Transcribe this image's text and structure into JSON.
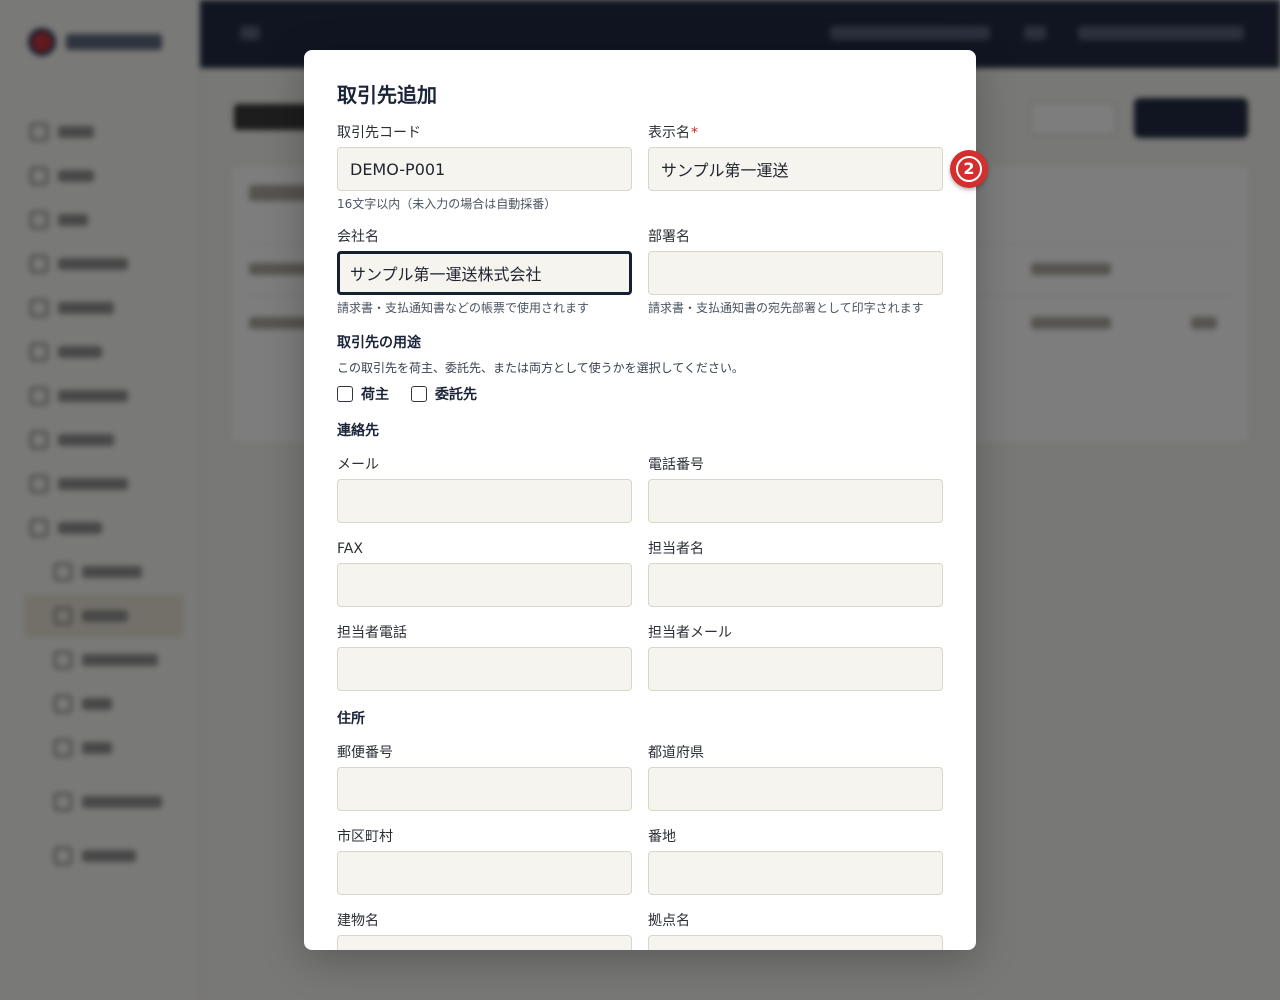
{
  "modal": {
    "title": "取引先追加",
    "fields": {
      "partner_code": {
        "label": "取引先コード",
        "value": "DEMO-P001",
        "hint": "16文字以内（未入力の場合は自動採番）"
      },
      "display_name": {
        "label": "表示名",
        "required_mark": "*",
        "value": "サンプル第一運送"
      },
      "company_name": {
        "label": "会社名",
        "value": "サンプル第一運送株式会社",
        "hint": "請求書・支払通知書などの帳票で使用されます"
      },
      "department": {
        "label": "部署名",
        "value": "",
        "hint": "請求書・支払通知書の宛先部署として印字されます"
      },
      "email": {
        "label": "メール",
        "value": ""
      },
      "phone": {
        "label": "電話番号",
        "value": ""
      },
      "fax": {
        "label": "FAX",
        "value": ""
      },
      "contact_name": {
        "label": "担当者名",
        "value": ""
      },
      "contact_phone": {
        "label": "担当者電話",
        "value": ""
      },
      "contact_email": {
        "label": "担当者メール",
        "value": ""
      },
      "postal_code": {
        "label": "郵便番号",
        "value": ""
      },
      "prefecture": {
        "label": "都道府県",
        "value": ""
      },
      "city": {
        "label": "市区町村",
        "value": ""
      },
      "street": {
        "label": "番地",
        "value": ""
      },
      "building": {
        "label": "建物名",
        "value": ""
      },
      "location": {
        "label": "拠点名",
        "value": ""
      }
    },
    "usage": {
      "title": "取引先の用途",
      "description": "この取引先を荷主、委託先、または両方として使うかを選択してください。",
      "options": [
        {
          "label": "荷主",
          "checked": false
        },
        {
          "label": "委託先",
          "checked": false
        }
      ]
    },
    "sections": {
      "contact": "連絡先",
      "address": "住所"
    }
  },
  "step_badge": {
    "label": "2"
  },
  "colors": {
    "primary_navy": "#0f1a33",
    "required_red": "#c62828",
    "badge_red": "#d32f2f",
    "input_bg": "#f6f4ee"
  }
}
